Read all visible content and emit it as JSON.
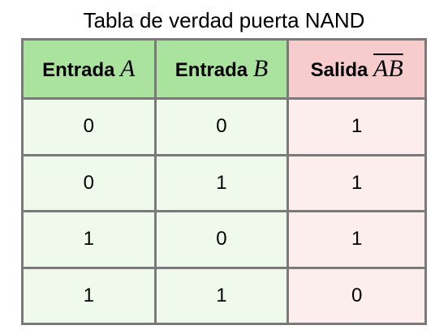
{
  "caption": "Tabla de verdad puerta NAND",
  "headers": {
    "input_a": {
      "label": "Entrada",
      "symbol": "A"
    },
    "input_b": {
      "label": "Entrada",
      "symbol": "B"
    },
    "output": {
      "label": "Salida",
      "symbol": "AB"
    }
  },
  "rows": [
    [
      "0",
      "0",
      "1"
    ],
    [
      "0",
      "1",
      "1"
    ],
    [
      "1",
      "0",
      "1"
    ],
    [
      "1",
      "1",
      "0"
    ]
  ],
  "colors": {
    "input_header": "#a9e39d",
    "output_header": "#f6cccc",
    "input_cell": "#effaed",
    "output_cell": "#fdeeee",
    "border": "#7a7a7a"
  }
}
